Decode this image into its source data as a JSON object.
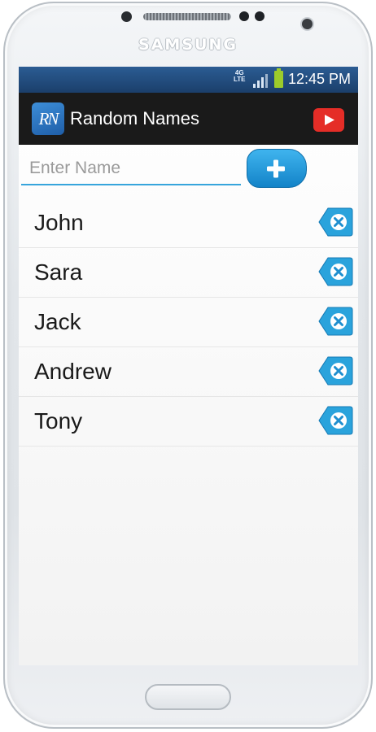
{
  "device": {
    "brand": "SAMSUNG"
  },
  "status_bar": {
    "network": "4G",
    "network_sub": "LTE",
    "time": "12:45 PM",
    "battery_color": "#9ccc2b"
  },
  "app": {
    "logo_text": "RN",
    "title": "Random Names",
    "youtube_icon": "youtube-play-icon",
    "accent_color": "#37a5dc"
  },
  "input": {
    "value": "",
    "placeholder": "Enter Name"
  },
  "add_button": {
    "icon": "plus-icon"
  },
  "names": [
    {
      "label": "John",
      "delete_icon": "delete-icon"
    },
    {
      "label": "Sara",
      "delete_icon": "delete-icon"
    },
    {
      "label": "Jack",
      "delete_icon": "delete-icon"
    },
    {
      "label": "Andrew",
      "delete_icon": "delete-icon"
    },
    {
      "label": "Tony",
      "delete_icon": "delete-icon"
    }
  ]
}
